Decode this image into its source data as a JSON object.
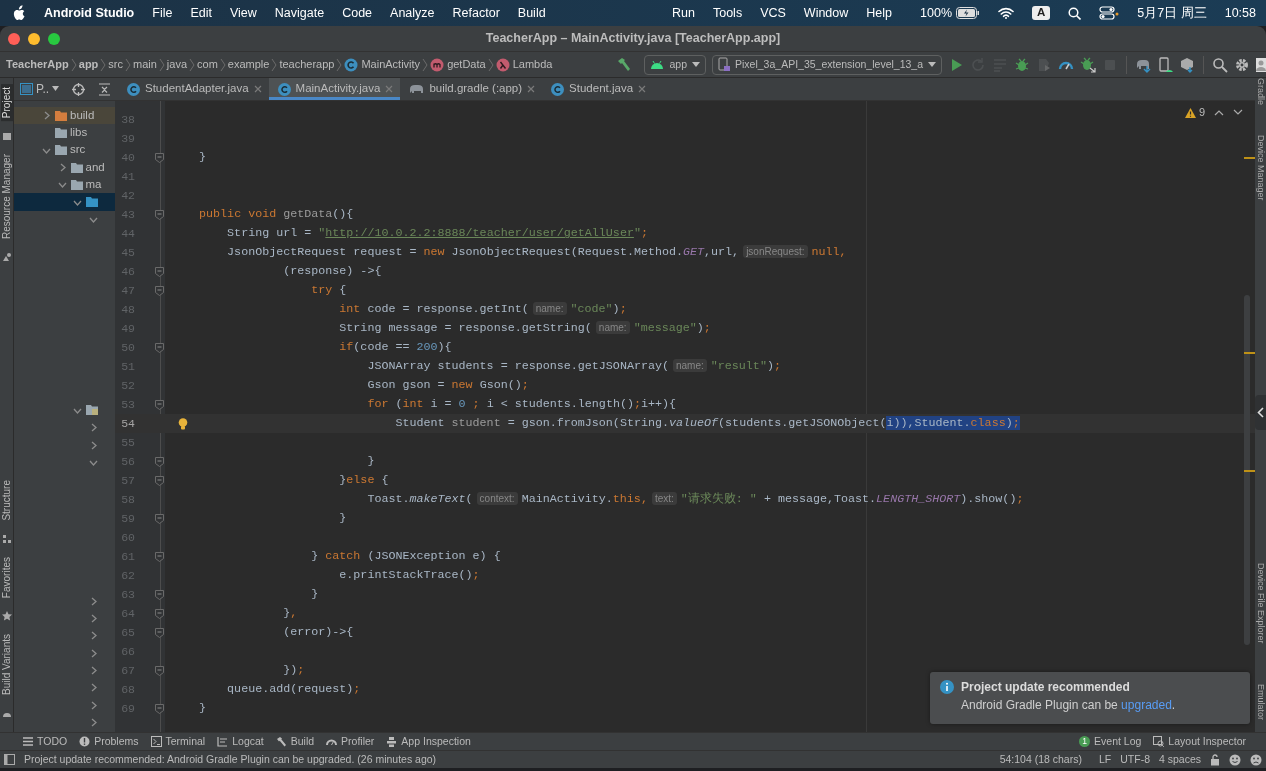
{
  "menu_bar": {
    "app_name": "Android Studio",
    "menus": [
      "File",
      "Edit",
      "View",
      "Navigate",
      "Code",
      "Analyze",
      "Refactor",
      "Build"
    ],
    "menus_right": [
      "Run",
      "Tools",
      "VCS",
      "Window",
      "Help"
    ],
    "battery": "100%",
    "input_source": "A",
    "date": "5月7日 周三",
    "time": "10:58"
  },
  "window": {
    "title": "TeacherApp – MainActivity.java [TeacherApp.app]"
  },
  "breadcrumbs": [
    {
      "label": "TeacherApp",
      "kind": "project"
    },
    {
      "label": "app",
      "kind": "module"
    },
    {
      "label": "src",
      "kind": "dir"
    },
    {
      "label": "main",
      "kind": "dir"
    },
    {
      "label": "java",
      "kind": "dir"
    },
    {
      "label": "com",
      "kind": "dir"
    },
    {
      "label": "example",
      "kind": "dir"
    },
    {
      "label": "teacherapp",
      "kind": "dir"
    },
    {
      "label": "MainActivity",
      "kind": "class"
    },
    {
      "label": "getData",
      "kind": "method"
    },
    {
      "label": "Lambda",
      "kind": "lambda"
    }
  ],
  "toolbar": {
    "config": "app",
    "device": "Pixel_3a_API_35_extension_level_13_a",
    "icons": [
      {
        "kind": "run",
        "disabled": false
      },
      {
        "kind": "rerun",
        "disabled": true
      },
      {
        "kind": "apply",
        "disabled": true
      },
      {
        "kind": "debug",
        "disabled": false
      },
      {
        "kind": "attach",
        "disabled": true
      },
      {
        "kind": "profile",
        "disabled": false
      },
      {
        "kind": "debug-attach",
        "disabled": false
      },
      {
        "kind": "stop",
        "disabled": true
      },
      {
        "kind": "sync",
        "disabled": false
      },
      {
        "kind": "device-manager",
        "disabled": false
      },
      {
        "kind": "sdk",
        "disabled": false
      },
      {
        "kind": "search",
        "disabled": false
      },
      {
        "kind": "settings",
        "disabled": false
      }
    ]
  },
  "left_strip": {
    "top": [
      {
        "label": "Project",
        "selected": true
      },
      {
        "label": "Resource Manager",
        "selected": false
      }
    ],
    "bottom": [
      {
        "label": "Structure",
        "selected": false
      },
      {
        "label": "Favorites",
        "selected": false
      },
      {
        "label": "Build Variants",
        "selected": false
      }
    ]
  },
  "project_panel": {
    "title": "P.."
  },
  "tree": [
    {
      "label": "build",
      "kind": "excluded",
      "expanded": false,
      "selected": false
    },
    {
      "label": "libs",
      "kind": "folder",
      "selected": false
    },
    {
      "label": "src",
      "kind": "folder",
      "expanded": true,
      "selected": false,
      "children": [
        {
          "label": "and",
          "kind": "folder",
          "expanded": false,
          "selected": false
        },
        {
          "label": "ma",
          "kind": "folder",
          "expanded": true,
          "selected": false,
          "children": [
            {
              "kind": "source",
              "expanded": true,
              "selected": true,
              "children": [
                {
                  "expanded": true,
                  "selected": false
                }
              ]
            },
            {
              "kind": "resources",
              "expanded": true,
              "selected": false,
              "children": [
                {
                  "expanded": false,
                  "selected": false
                },
                {
                  "expanded": false,
                  "selected": false
                },
                {
                  "expanded": true,
                  "selected": false
                },
                {
                  "expanded": false,
                  "selected": false
                },
                {
                  "expanded": false,
                  "selected": false
                },
                {
                  "expanded": false,
                  "selected": false
                },
                {
                  "expanded": false,
                  "selected": false
                },
                {
                  "expanded": false,
                  "selected": false
                },
                {
                  "expanded": false,
                  "selected": false
                },
                {
                  "expanded": false,
                  "selected": false
                },
                {
                  "expanded": false,
                  "selected": false
                }
              ]
            }
          ]
        }
      ]
    }
  ],
  "editor_tabs": [
    {
      "label": "StudentAdapter.java",
      "kind": "class",
      "selected": false
    },
    {
      "label": "MainActivity.java",
      "kind": "class",
      "selected": true
    },
    {
      "label": "build.gradle (:app)",
      "kind": "gradle",
      "selected": false
    },
    {
      "label": "Student.java",
      "kind": "class",
      "selected": false
    }
  ],
  "editor": {
    "problems": "9",
    "lines": [
      {
        "number": "38",
        "fold": false,
        "current": false
      },
      {
        "number": "39",
        "fold": false,
        "current": false
      },
      {
        "number": "40",
        "fold": true,
        "current": false,
        "tokens": [
          {
            "text": "    }",
            "kind": "plain"
          }
        ]
      },
      {
        "number": "41",
        "fold": false,
        "current": false
      },
      {
        "number": "42",
        "fold": false,
        "current": false
      },
      {
        "number": "43",
        "fold": true,
        "current": false,
        "tokens": [
          {
            "text": "    public void ",
            "kind": "keyword"
          },
          {
            "text": "getData",
            "kind": "dim"
          },
          {
            "text": "(){",
            "kind": "plain"
          }
        ]
      },
      {
        "number": "44",
        "fold": false,
        "current": false,
        "tokens": [
          {
            "text": "        String url = ",
            "kind": "plain"
          },
          {
            "text": "\"",
            "kind": "string"
          },
          {
            "text": "http://10.0.2.2:8888/teacher/user/getAllUser",
            "kind": "url"
          },
          {
            "text": "\"",
            "kind": "string"
          },
          {
            "text": ";",
            "kind": "keyword"
          }
        ]
      },
      {
        "number": "45",
        "fold": false,
        "current": false,
        "tokens": [
          {
            "text": "        JsonObjectRequest request = ",
            "kind": "plain"
          },
          {
            "text": "new ",
            "kind": "keyword"
          },
          {
            "text": "JsonObjectRequest(Request.Method.",
            "kind": "plain"
          },
          {
            "text": "GET",
            "kind": "constant"
          },
          {
            "text": ",url,",
            "kind": "plain"
          },
          {
            "text": "jsonRequest:",
            "kind": "hint"
          },
          {
            "text": "null,",
            "kind": "keyword"
          }
        ]
      },
      {
        "number": "46",
        "fold": true,
        "current": false,
        "tokens": [
          {
            "text": "                (response) ->{",
            "kind": "plain"
          }
        ]
      },
      {
        "number": "47",
        "fold": true,
        "current": false,
        "tokens": [
          {
            "text": "                    try ",
            "kind": "keyword"
          },
          {
            "text": "{",
            "kind": "plain"
          }
        ]
      },
      {
        "number": "48",
        "fold": false,
        "current": false,
        "tokens": [
          {
            "text": "                        int ",
            "kind": "keyword"
          },
          {
            "text": "code = response.getInt(",
            "kind": "plain"
          },
          {
            "text": "name:",
            "kind": "hint"
          },
          {
            "text": "\"code\"",
            "kind": "string"
          },
          {
            "text": ")",
            "kind": "plain"
          },
          {
            "text": ";",
            "kind": "keyword"
          }
        ]
      },
      {
        "number": "49",
        "fold": false,
        "current": false,
        "tokens": [
          {
            "text": "                        String message = response.getString(",
            "kind": "plain"
          },
          {
            "text": "name:",
            "kind": "hint"
          },
          {
            "text": "\"message\"",
            "kind": "string"
          },
          {
            "text": ")",
            "kind": "plain"
          },
          {
            "text": ";",
            "kind": "keyword"
          }
        ]
      },
      {
        "number": "50",
        "fold": true,
        "current": false,
        "tokens": [
          {
            "text": "                        if",
            "kind": "keyword"
          },
          {
            "text": "(code == ",
            "kind": "plain"
          },
          {
            "text": "200",
            "kind": "number"
          },
          {
            "text": "){",
            "kind": "plain"
          }
        ]
      },
      {
        "number": "51",
        "fold": false,
        "current": false,
        "tokens": [
          {
            "text": "                            JSONArray students = response.getJSONArray(",
            "kind": "plain"
          },
          {
            "text": "name:",
            "kind": "hint"
          },
          {
            "text": "\"result\"",
            "kind": "string"
          },
          {
            "text": ")",
            "kind": "plain"
          },
          {
            "text": ";",
            "kind": "keyword"
          }
        ]
      },
      {
        "number": "52",
        "fold": false,
        "current": false,
        "tokens": [
          {
            "text": "                            Gson gson = ",
            "kind": "plain"
          },
          {
            "text": "new ",
            "kind": "keyword"
          },
          {
            "text": "Gson()",
            "kind": "plain"
          },
          {
            "text": ";",
            "kind": "keyword"
          }
        ]
      },
      {
        "number": "53",
        "fold": true,
        "current": false,
        "tokens": [
          {
            "text": "                            for ",
            "kind": "keyword"
          },
          {
            "text": "(",
            "kind": "plain"
          },
          {
            "text": "int ",
            "kind": "keyword"
          },
          {
            "text": "i = ",
            "kind": "plain"
          },
          {
            "text": "0",
            "kind": "number"
          },
          {
            "text": " ; ",
            "kind": "keyword"
          },
          {
            "text": "i < students.length()",
            "kind": "plain"
          },
          {
            "text": ";",
            "kind": "keyword"
          },
          {
            "text": "i++){",
            "kind": "plain"
          }
        ]
      },
      {
        "number": "54",
        "fold": false,
        "current": true,
        "tokens": [
          {
            "text": "                                Student ",
            "kind": "plain"
          },
          {
            "text": "student",
            "kind": "dim"
          },
          {
            "text": " = gson.fromJson(String.",
            "kind": "plain"
          },
          {
            "text": "valueOf",
            "kind": "italic"
          },
          {
            "text": "(students.getJSONObject(",
            "kind": "plain"
          },
          {
            "text": "i)),Student.",
            "kind": "selection"
          },
          {
            "text": "class",
            "kind": "selection-keyword"
          },
          {
            "text": ")",
            "kind": "selection"
          },
          {
            "text": ";",
            "kind": "selection-keyword"
          }
        ]
      },
      {
        "number": "55",
        "fold": false,
        "current": false
      },
      {
        "number": "56",
        "fold": true,
        "current": false,
        "tokens": [
          {
            "text": "                            }",
            "kind": "plain"
          }
        ]
      },
      {
        "number": "57",
        "fold": true,
        "current": false,
        "tokens": [
          {
            "text": "                        }",
            "kind": "plain"
          },
          {
            "text": "else ",
            "kind": "keyword"
          },
          {
            "text": "{",
            "kind": "plain"
          }
        ]
      },
      {
        "number": "58",
        "fold": false,
        "current": false,
        "tokens": [
          {
            "text": "                            Toast.",
            "kind": "plain"
          },
          {
            "text": "makeText",
            "kind": "italic"
          },
          {
            "text": "(",
            "kind": "plain"
          },
          {
            "text": "context:",
            "kind": "hint"
          },
          {
            "text": "MainActivity.",
            "kind": "plain"
          },
          {
            "text": "this,",
            "kind": "keyword"
          },
          {
            "text": "text:",
            "kind": "hint"
          },
          {
            "text": "\"请求失败: \"",
            "kind": "string"
          },
          {
            "text": " + message,Toast.",
            "kind": "plain"
          },
          {
            "text": "LENGTH_SHORT",
            "kind": "constant"
          },
          {
            "text": ").show()",
            "kind": "plain"
          },
          {
            "text": ";",
            "kind": "keyword"
          }
        ]
      },
      {
        "number": "59",
        "fold": true,
        "current": false,
        "tokens": [
          {
            "text": "                        }",
            "kind": "plain"
          }
        ]
      },
      {
        "number": "60",
        "fold": false,
        "current": false
      },
      {
        "number": "61",
        "fold": true,
        "current": false,
        "tokens": [
          {
            "text": "                    } ",
            "kind": "plain"
          },
          {
            "text": "catch ",
            "kind": "keyword"
          },
          {
            "text": "(JSONException e) {",
            "kind": "plain"
          }
        ]
      },
      {
        "number": "62",
        "fold": false,
        "current": false,
        "tokens": [
          {
            "text": "                        e.printStackTrace()",
            "kind": "plain"
          },
          {
            "text": ";",
            "kind": "keyword"
          }
        ]
      },
      {
        "number": "63",
        "fold": true,
        "current": false,
        "tokens": [
          {
            "text": "                    }",
            "kind": "plain"
          }
        ]
      },
      {
        "number": "64",
        "fold": true,
        "current": false,
        "tokens": [
          {
            "text": "                }",
            "kind": "plain"
          },
          {
            "text": ",",
            "kind": "keyword"
          }
        ]
      },
      {
        "number": "65",
        "fold": true,
        "current": false,
        "tokens": [
          {
            "text": "                (error)->{",
            "kind": "plain"
          }
        ]
      },
      {
        "number": "66",
        "fold": false,
        "current": false
      },
      {
        "number": "67",
        "fold": true,
        "current": false,
        "tokens": [
          {
            "text": "                })",
            "kind": "plain"
          },
          {
            "text": ";",
            "kind": "keyword"
          }
        ]
      },
      {
        "number": "68",
        "fold": false,
        "current": false,
        "tokens": [
          {
            "text": "        queue.add(request)",
            "kind": "plain"
          },
          {
            "text": ";",
            "kind": "keyword"
          }
        ]
      },
      {
        "number": "69",
        "fold": true,
        "current": false,
        "tokens": [
          {
            "text": "    }",
            "kind": "plain"
          }
        ]
      }
    ]
  },
  "right_strip": {
    "top": [
      "Gradle",
      "Device Manager"
    ],
    "bottom": [
      "Device File Explorer",
      "Emulator"
    ]
  },
  "notification": {
    "title": "Project update recommended",
    "text": "Android Gradle Plugin can be ",
    "link": "upgraded",
    "after": "."
  },
  "tool_windows": {
    "left": [
      {
        "label": "TODO",
        "kind": "todo"
      },
      {
        "label": "Problems",
        "kind": "problems"
      },
      {
        "label": "Terminal",
        "kind": "terminal"
      },
      {
        "label": "Logcat",
        "kind": "logcat"
      },
      {
        "label": "Build",
        "kind": "build"
      },
      {
        "label": "Profiler",
        "kind": "profiler"
      },
      {
        "label": "App Inspection",
        "kind": "inspection"
      }
    ],
    "right": [
      {
        "label": "Event Log",
        "kind": "event",
        "badge": "1"
      },
      {
        "label": "Layout Inspector",
        "kind": "layout"
      }
    ]
  },
  "status_bar": {
    "message": "Project update recommended: Android Gradle Plugin can be upgraded. (26 minutes ago)",
    "position": "54:104 (18 chars)",
    "line_separator": "LF",
    "encoding": "UTF-8",
    "indent": "4 spaces"
  }
}
